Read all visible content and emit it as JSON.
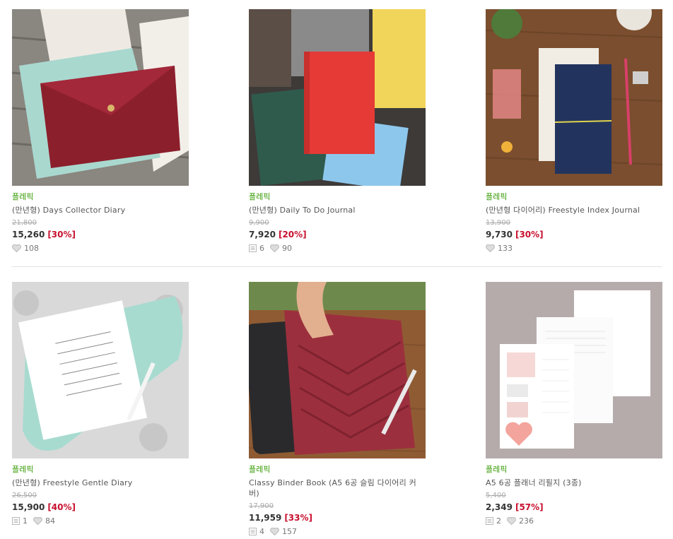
{
  "products": [
    {
      "brand": "플레픽",
      "name": "(만년형) Days Collector Diary",
      "original_price": "21,800",
      "price": "15,260",
      "discount": "[30%]",
      "reviews": "",
      "likes": "108"
    },
    {
      "brand": "플레픽",
      "name": "(만년형) Daily To Do Journal",
      "original_price": "9,900",
      "price": "7,920",
      "discount": "[20%]",
      "reviews": "6",
      "likes": "90"
    },
    {
      "brand": "플레픽",
      "name": "(만년형 다이어리) Freestyle Index Journal",
      "original_price": "13,900",
      "price": "9,730",
      "discount": "[30%]",
      "reviews": "",
      "likes": "133"
    },
    {
      "brand": "플레픽",
      "name": "(만년형) Freestyle Gentle Diary",
      "original_price": "26,500",
      "price": "15,900",
      "discount": "[40%]",
      "reviews": "1",
      "likes": "84"
    },
    {
      "brand": "플레픽",
      "name": "Classy Binder Book (A5 6공 슬림 다이어리 커버)",
      "original_price": "17,900",
      "price": "11,959",
      "discount": "[33%]",
      "reviews": "4",
      "likes": "157"
    },
    {
      "brand": "플레픽",
      "name": "A5 6공 플래너 리필지 (3종)",
      "original_price": "5,400",
      "price": "2,349",
      "discount": "[57%]",
      "reviews": "2",
      "likes": "236"
    }
  ],
  "colors": {
    "brand": "#339900",
    "discount": "#c8102e",
    "icon": "#b8b8b8"
  },
  "icons": {
    "review": "review-icon",
    "like": "heart-icon"
  }
}
